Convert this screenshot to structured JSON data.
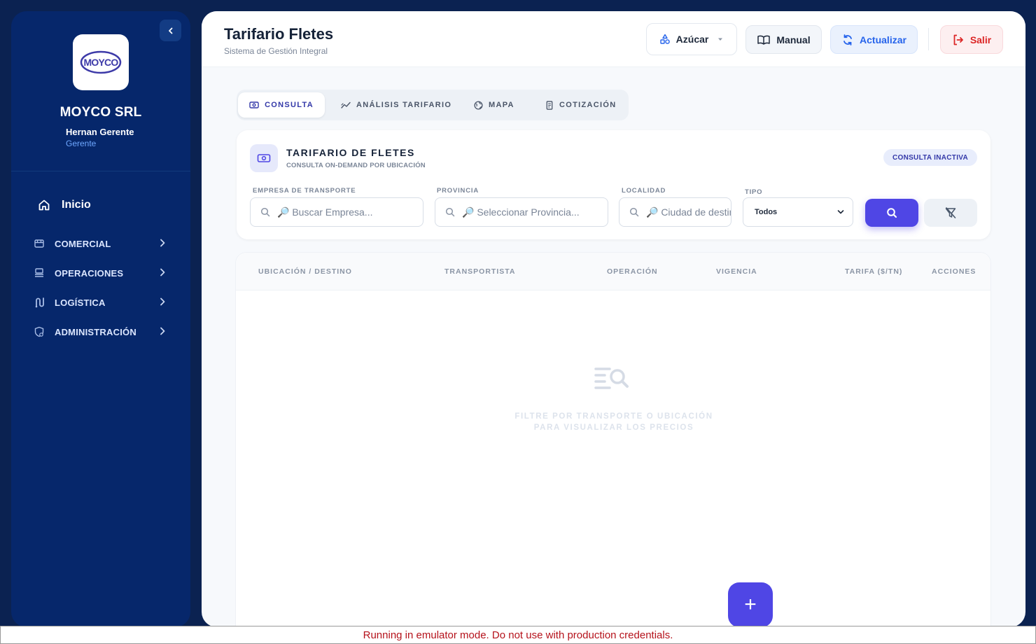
{
  "sidebar": {
    "logo_text": "MOYCO",
    "company": "MOYCO SRL",
    "user_name": "Hernan Gerente",
    "user_role": "Gerente",
    "home_label": "Inicio",
    "sections": [
      {
        "label": "COMERCIAL",
        "icon": "store-icon"
      },
      {
        "label": "OPERACIONES",
        "icon": "inbox-stack-icon"
      },
      {
        "label": "LOGÍSTICA",
        "icon": "route-icon"
      },
      {
        "label": "ADMINISTRACIÓN",
        "icon": "shield-user-icon"
      }
    ]
  },
  "header": {
    "title": "Tarifario Fletes",
    "subtitle": "Sistema de Gestión Integral",
    "product_label": "Azúcar",
    "manual_label": "Manual",
    "refresh_label": "Actualizar",
    "exit_label": "Salir"
  },
  "tabs": [
    {
      "label": "CONSULTA",
      "active": true
    },
    {
      "label": "ANÁLISIS TARIFARIO",
      "active": false
    },
    {
      "label": "MAPA",
      "active": false
    },
    {
      "label": "COTIZACIÓN",
      "active": false
    }
  ],
  "filter_card": {
    "title": "TARIFARIO DE FLETES",
    "subtitle": "CONSULTA ON-DEMAND POR UBICACIÓN",
    "status_badge": "CONSULTA INACTIVA",
    "fields": {
      "empresa_label": "EMPRESA DE TRANSPORTE",
      "empresa_placeholder": "🔎 Buscar Empresa...",
      "provincia_label": "PROVINCIA",
      "provincia_placeholder": "🔎 Seleccionar Provincia...",
      "localidad_label": "LOCALIDAD",
      "localidad_placeholder": "🔎 Ciudad de destino...",
      "tipo_label": "TIPO",
      "tipo_value": "Todos"
    }
  },
  "table": {
    "columns": [
      "UBICACIÓN / DESTINO",
      "TRANSPORTISTA",
      "OPERACIÓN",
      "VIGENCIA",
      "TARIFA ($/TN)",
      "ACCIONES"
    ],
    "empty_line1": "FILTRE POR TRANSPORTE O UBICACIÓN",
    "empty_line2": "PARA VISUALIZAR LOS PRECIOS"
  },
  "fab_label": "+",
  "emulator_banner": "Running in emulator mode. Do not use with production credentials.",
  "colors": {
    "page_bg": "#0b2251",
    "sidebar_bg": "#06276b",
    "accent": "#4f46e5",
    "refresh": "#2563eb",
    "exit": "#dc2626",
    "banner_text": "#b5121b"
  }
}
